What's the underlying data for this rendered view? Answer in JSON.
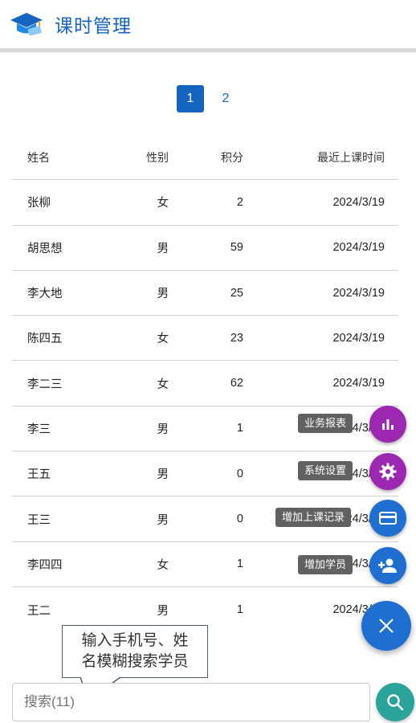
{
  "header": {
    "title": "课时管理",
    "logo_icon": "graduation-cap-icon"
  },
  "pagination": {
    "pages": [
      "1",
      "2"
    ],
    "current": "1"
  },
  "table": {
    "columns": {
      "name": "姓名",
      "gender": "性别",
      "score": "积分",
      "last_class": "最近上课时间"
    },
    "rows": [
      {
        "name": "张柳",
        "gender": "女",
        "score": "2",
        "date": "2024/3/19"
      },
      {
        "name": "胡思想",
        "gender": "男",
        "score": "59",
        "date": "2024/3/19"
      },
      {
        "name": "李大地",
        "gender": "男",
        "score": "25",
        "date": "2024/3/19"
      },
      {
        "name": "陈四五",
        "gender": "女",
        "score": "23",
        "date": "2024/3/19"
      },
      {
        "name": "李二三",
        "gender": "女",
        "score": "62",
        "date": "2024/3/19"
      },
      {
        "name": "李三",
        "gender": "男",
        "score": "1",
        "date": "2024/3/19"
      },
      {
        "name": "王五",
        "gender": "男",
        "score": "0",
        "date": "2024/3/19"
      },
      {
        "name": "王三",
        "gender": "男",
        "score": "0",
        "date": "2024/3/19"
      },
      {
        "name": "李四四",
        "gender": "女",
        "score": "1",
        "date": "2024/3/19"
      },
      {
        "name": "王二",
        "gender": "男",
        "score": "1",
        "date": "2024/3/19"
      }
    ]
  },
  "fab": {
    "items": [
      {
        "label": "业务报表",
        "icon": "bar-chart-icon",
        "color": "#9c27b0"
      },
      {
        "label": "系统设置",
        "icon": "gear-icon",
        "color": "#9c27b0"
      },
      {
        "label": "增加上课记录",
        "icon": "credit-card-icon",
        "color": "#1e6fcf"
      },
      {
        "label": "增加学员",
        "icon": "add-person-icon",
        "color": "#1e6fcf"
      }
    ],
    "main_icon": "close-icon",
    "main_color": "#1e6fcf"
  },
  "tooltip": {
    "line1": "输入手机号、姓",
    "line2": "名模糊搜索学员"
  },
  "search": {
    "placeholder": "搜索(11)",
    "button_icon": "search-icon",
    "button_color": "#2aa39a"
  }
}
